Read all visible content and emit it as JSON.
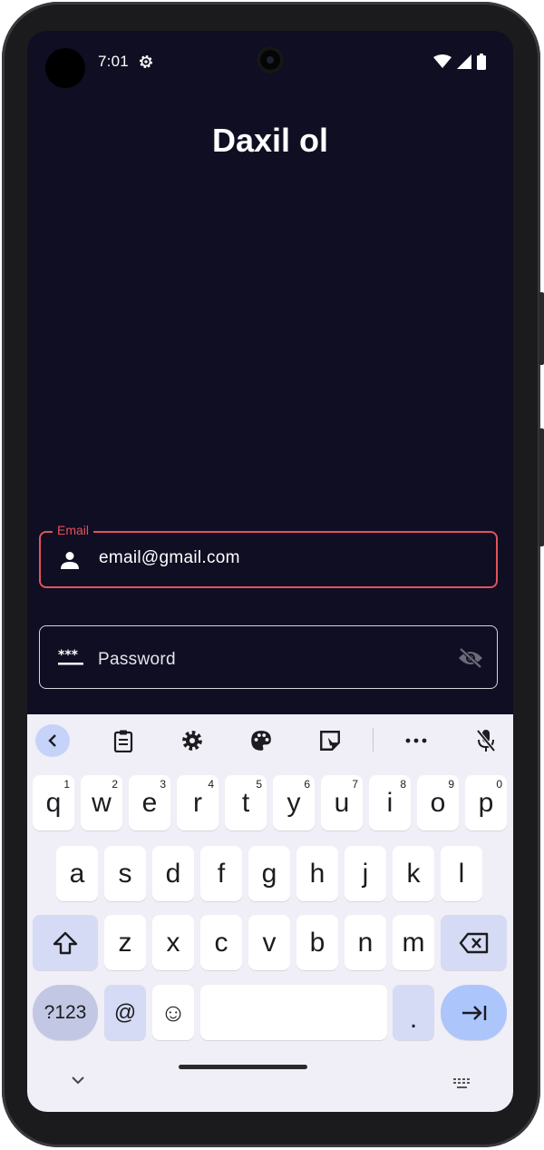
{
  "status_bar": {
    "time": "7:01"
  },
  "app": {
    "title": "Daxil ol"
  },
  "email_field": {
    "label": "Email",
    "value": "email@gmail.com",
    "icon": "person-icon"
  },
  "password_field": {
    "placeholder": "Password",
    "icon": "password-dots-icon",
    "toggle_icon": "visibility-off-icon"
  },
  "keyboard": {
    "toolbar": [
      "back-chevron-icon",
      "clipboard-icon",
      "gear-icon",
      "palette-icon",
      "sticker-icon",
      "more-icon",
      "mic-off-icon"
    ],
    "row1": [
      {
        "k": "q",
        "h": "1"
      },
      {
        "k": "w",
        "h": "2"
      },
      {
        "k": "e",
        "h": "3"
      },
      {
        "k": "r",
        "h": "4"
      },
      {
        "k": "t",
        "h": "5"
      },
      {
        "k": "y",
        "h": "6"
      },
      {
        "k": "u",
        "h": "7"
      },
      {
        "k": "i",
        "h": "8"
      },
      {
        "k": "o",
        "h": "9"
      },
      {
        "k": "p",
        "h": "0"
      }
    ],
    "row2": [
      "a",
      "s",
      "d",
      "f",
      "g",
      "h",
      "j",
      "k",
      "l"
    ],
    "row3": [
      "z",
      "x",
      "c",
      "v",
      "b",
      "n",
      "m"
    ],
    "sym_label": "?123",
    "at_label": "@",
    "emoji_label": "☺",
    "period_label": "."
  },
  "colors": {
    "background": "#0f0e22",
    "error": "#e2535b",
    "keyboard": "#f0eef6",
    "accent": "#acc5fb"
  }
}
